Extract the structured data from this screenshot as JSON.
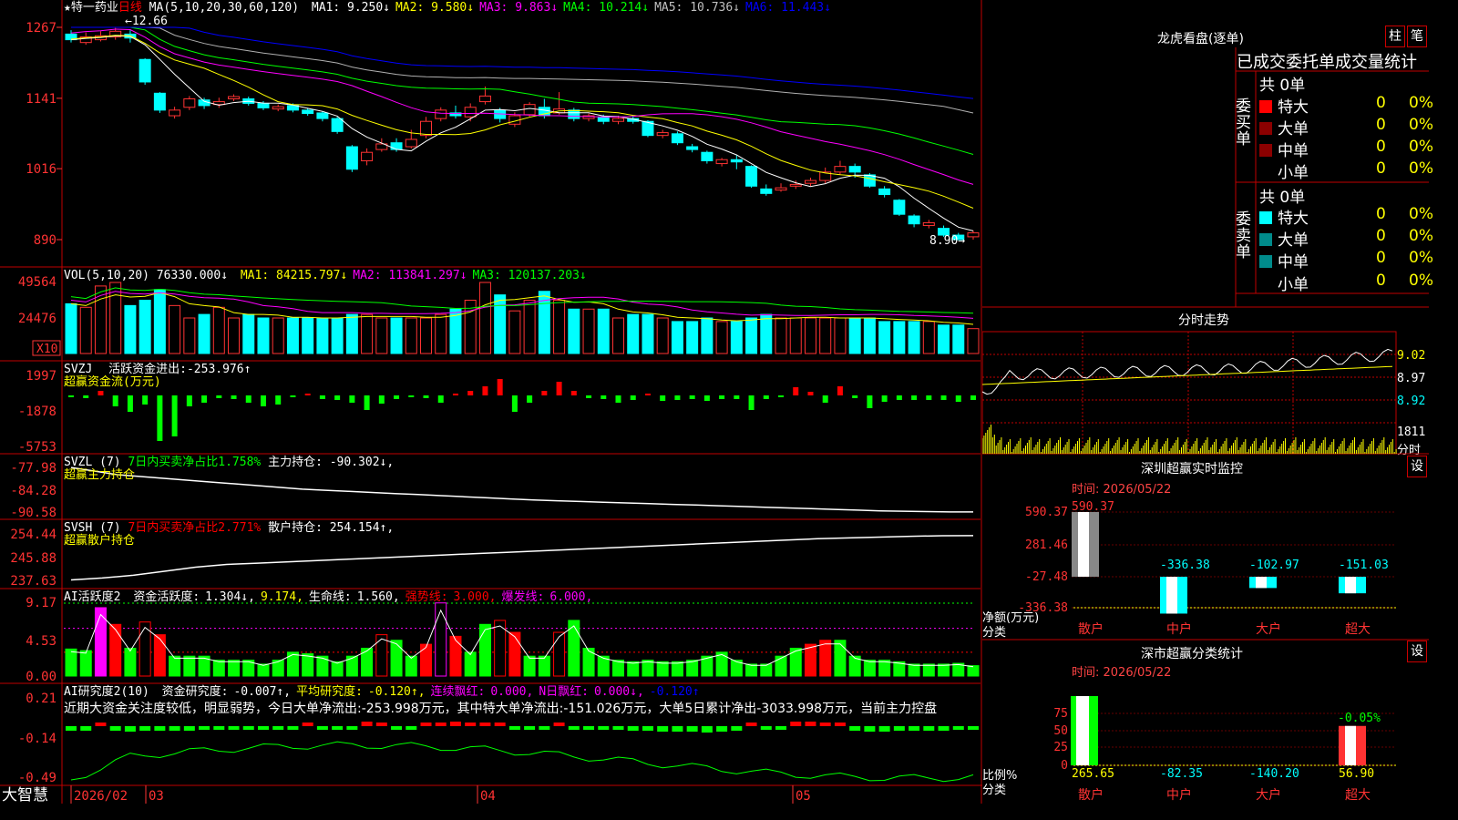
{
  "colors": {
    "up": "#ff3333",
    "down": "#00ffff",
    "vol_up": "#ff3333",
    "vol_down": "#00ffff",
    "frame": "#c00000",
    "ma1": "#ffffff",
    "ma2": "#ffff00",
    "ma3": "#ff00ff",
    "ma4": "#00ff00",
    "ma5": "#b0b0b0",
    "ma6": "#0000ff",
    "green_bar": "#00ff00",
    "red_bar": "#ff0000",
    "magenta_bar": "#ff00ff"
  },
  "price_panel": {
    "stock_name": "★特一药业",
    "period": "日线",
    "ma_label": "MA(5,10,20,30,60,120)",
    "ma_values": [
      {
        "name": "MA1:",
        "value": "9.250↓",
        "color": "#ffffff"
      },
      {
        "name": "MA2:",
        "value": "9.580↓",
        "color": "#ffff00"
      },
      {
        "name": "MA3:",
        "value": "9.863↓",
        "color": "#ff00ff"
      },
      {
        "name": "MA4:",
        "value": "10.214↓",
        "color": "#00ff00"
      },
      {
        "name": "MA5:",
        "value": "10.736↓",
        "color": "#c0c0c0"
      },
      {
        "name": "MA6:",
        "value": "11.443↓",
        "color": "#0000ff"
      }
    ],
    "y_ticks": [
      "1267",
      "1141",
      "1016",
      "890"
    ],
    "high_label": "12.66",
    "low_label": "8.90"
  },
  "vol_panel": {
    "label": "VOL(5,10,20)",
    "value": "76330.000↓",
    "ma_values": [
      {
        "name": "MA1:",
        "value": "84215.797↓",
        "color": "#ffff00"
      },
      {
        "name": "MA2:",
        "value": "113841.297↓",
        "color": "#ff00ff"
      },
      {
        "name": "MA3:",
        "value": "120137.203↓",
        "color": "#00ff00"
      }
    ],
    "y_ticks": [
      "49564",
      "24476"
    ],
    "unit": "X10"
  },
  "svzj_panel": {
    "label": "SVZJ",
    "desc": "活跃资金进出:",
    "value": "-253.976↑",
    "sub": "超赢资金流(万元)",
    "y_ticks": [
      "1997",
      "-1878",
      "-5753"
    ]
  },
  "svzl_panel": {
    "label": "SVZL (7)",
    "desc": "7日内买卖净占比1.758%",
    "desc2": "主力持仓:",
    "value": "-90.302↓,",
    "sub": "超赢主力持仓",
    "y_ticks": [
      "-77.98",
      "-84.28",
      "-90.58"
    ]
  },
  "svsh_panel": {
    "label": "SVSH (7)",
    "desc": "7日内买卖净占比2.771%",
    "desc2": "散户持仓:",
    "value": "254.154↑,",
    "sub": "超赢散户持仓",
    "y_ticks": [
      "254.44",
      "245.88",
      "237.63"
    ]
  },
  "ai1_panel": {
    "label": "AI活跃度2",
    "items": [
      {
        "t": "资金活跃度:",
        "c": "#ffffff"
      },
      {
        "t": "1.304↓,",
        "c": "#ffffff"
      },
      {
        "t": "9.174,",
        "c": "#ffff00"
      },
      {
        "t": "生命线:",
        "c": "#ffffff"
      },
      {
        "t": "1.560,",
        "c": "#ffffff"
      },
      {
        "t": "强势线:",
        "c": "#ff0000"
      },
      {
        "t": "3.000,",
        "c": "#ff0000"
      },
      {
        "t": "爆发线:",
        "c": "#ff00ff"
      },
      {
        "t": "6.000,",
        "c": "#ff00ff"
      }
    ],
    "y_ticks": [
      "9.17",
      "4.53",
      "0.00"
    ]
  },
  "ai2_panel": {
    "label": "AI研究度2(10)",
    "items": [
      {
        "t": "资金研究度:",
        "c": "#ffffff"
      },
      {
        "t": "-0.007↑,",
        "c": "#ffffff"
      },
      {
        "t": "平均研究度:",
        "c": "#ffff00"
      },
      {
        "t": "-0.120↑,",
        "c": "#ffff00"
      },
      {
        "t": "连续飘红:",
        "c": "#ff00ff"
      },
      {
        "t": "0.000,",
        "c": "#ff00ff"
      },
      {
        "t": "N日飘红:",
        "c": "#ff00ff"
      },
      {
        "t": "0.000↓,",
        "c": "#ff00ff"
      },
      {
        "t": "-0.120↑",
        "c": "#0000ff"
      }
    ],
    "comment": "近期大资金关注度较低，明显弱势，今日大单净流出:-253.998万元，其中特大单净流出:-151.026万元，大单5日累计净出-3033.998万元，当前主力控盘",
    "y_ticks": [
      "0.21",
      "-0.14",
      "-0.49"
    ]
  },
  "x_axis": {
    "brand": "大智慧",
    "labels": [
      "2026/02",
      "03",
      "04",
      "05"
    ]
  },
  "lhb": {
    "title": "龙虎看盘(逐单)",
    "tab_col": "柱",
    "tab_row": "笔",
    "header": "已成交委托单成交量统计",
    "buy_side": "委买单",
    "sell_side": "委卖单",
    "buy_total": "共 0单",
    "sell_total": "共 0单",
    "rows": [
      {
        "name": "特大",
        "count": "0",
        "pct": "0%"
      },
      {
        "name": "大单",
        "count": "0",
        "pct": "0%"
      },
      {
        "name": "中单",
        "count": "0",
        "pct": "0%"
      },
      {
        "name": "小单",
        "count": "0",
        "pct": "0%"
      }
    ]
  },
  "intraday": {
    "title": "分时走势",
    "price_ticks": [
      "9.02",
      "8.97",
      "8.92"
    ],
    "vol_tick": "1811",
    "vol_unit": "分时"
  },
  "sz_monitor": {
    "title": "深圳超赢实时监控",
    "time": "时间: 2026/05/22",
    "settings": "设",
    "y_ticks": [
      "590.37",
      "281.46",
      "-27.48",
      "-336.38"
    ],
    "ylabel": "净额(万元)",
    "xlabel": "分类",
    "categories": [
      "散户",
      "中户",
      "大户",
      "超大"
    ],
    "values": [
      590.37,
      -336.38,
      -102.97,
      -151.03
    ],
    "value_labels": [
      "590.37",
      "-336.38",
      "-102.97",
      "-151.03"
    ]
  },
  "sz_class": {
    "title": "深市超赢分类统计",
    "time": "时间: 2026/05/22",
    "settings": "设",
    "y_ticks": [
      "75",
      "50",
      "25",
      "0"
    ],
    "ylabel": "比例%",
    "xlabel": "分类",
    "categories": [
      "散户",
      "中户",
      "大户",
      "超大"
    ],
    "values": [
      265.65,
      -82.35,
      -140.2,
      56.9
    ],
    "value_labels": [
      "265.65",
      "-82.35",
      "-140.20",
      "56.90"
    ],
    "top_label": "-0.05%"
  },
  "chart_data": [
    {
      "type": "candlestick",
      "title": "★特一药业 日线",
      "ylim": [
        8.9,
        12.67
      ],
      "x": [
        "2026/02",
        "03",
        "04",
        "05"
      ],
      "series": [
        {
          "name": "K线",
          "ohlc": [
            [
              12.55,
              12.45,
              12.62,
              12.4
            ],
            [
              12.4,
              12.5,
              12.58,
              12.36
            ],
            [
              12.45,
              12.52,
              12.6,
              12.42
            ],
            [
              12.5,
              12.6,
              12.66,
              12.45
            ],
            [
              12.55,
              12.48,
              12.62,
              12.4
            ],
            [
              12.1,
              11.7,
              12.12,
              11.65
            ],
            [
              11.5,
              11.2,
              11.52,
              11.15
            ],
            [
              11.1,
              11.2,
              11.26,
              11.05
            ],
            [
              11.25,
              11.4,
              11.45,
              11.2
            ],
            [
              11.38,
              11.28,
              11.42,
              11.22
            ],
            [
              11.3,
              11.35,
              11.42,
              11.24
            ],
            [
              11.4,
              11.44,
              11.48,
              11.36
            ],
            [
              11.4,
              11.32,
              11.44,
              11.28
            ],
            [
              11.32,
              11.24,
              11.36,
              11.2
            ],
            [
              11.22,
              11.26,
              11.3,
              11.18
            ],
            [
              11.28,
              11.2,
              11.32,
              11.16
            ],
            [
              11.2,
              11.14,
              11.24,
              11.1
            ],
            [
              11.15,
              11.05,
              11.18,
              11.0
            ],
            [
              11.05,
              10.82,
              11.08,
              10.78
            ],
            [
              10.55,
              10.15,
              10.58,
              10.1
            ],
            [
              10.3,
              10.45,
              10.52,
              10.22
            ],
            [
              10.5,
              10.6,
              10.7,
              10.46
            ],
            [
              10.62,
              10.5,
              10.7,
              10.46
            ],
            [
              10.55,
              10.68,
              10.85,
              10.52
            ],
            [
              10.75,
              11.0,
              11.08,
              10.7
            ],
            [
              11.05,
              11.2,
              11.25,
              11.0
            ],
            [
              11.15,
              11.1,
              11.28,
              11.05
            ],
            [
              11.08,
              11.25,
              11.32,
              11.0
            ],
            [
              11.35,
              11.45,
              11.62,
              11.3
            ],
            [
              11.2,
              11.05,
              11.24,
              10.98
            ],
            [
              10.95,
              11.1,
              11.16,
              10.9
            ],
            [
              11.12,
              11.3,
              11.34,
              11.08
            ],
            [
              11.25,
              11.1,
              11.4,
              11.05
            ],
            [
              11.15,
              11.22,
              11.52,
              11.12
            ],
            [
              11.2,
              11.05,
              11.24,
              11.0
            ],
            [
              11.05,
              11.1,
              11.14,
              11.0
            ],
            [
              11.08,
              11.0,
              11.12,
              10.95
            ],
            [
              11.0,
              11.05,
              11.1,
              10.95
            ],
            [
              11.05,
              11.0,
              11.1,
              10.96
            ],
            [
              11.0,
              10.75,
              11.02,
              10.72
            ],
            [
              10.75,
              10.8,
              10.85,
              10.7
            ],
            [
              10.78,
              10.62,
              10.82,
              10.58
            ],
            [
              10.55,
              10.5,
              10.6,
              10.45
            ],
            [
              10.45,
              10.3,
              10.48,
              10.25
            ],
            [
              10.25,
              10.32,
              10.35,
              10.2
            ],
            [
              10.32,
              10.28,
              10.4,
              10.15
            ],
            [
              10.2,
              9.85,
              10.22,
              9.82
            ],
            [
              9.8,
              9.72,
              9.88,
              9.68
            ],
            [
              9.78,
              9.82,
              9.9,
              9.75
            ],
            [
              9.85,
              9.88,
              9.95,
              9.8
            ],
            [
              9.9,
              9.95,
              10.0,
              9.85
            ],
            [
              9.95,
              10.1,
              10.18,
              9.9
            ],
            [
              10.1,
              10.2,
              10.3,
              10.05
            ],
            [
              10.2,
              10.1,
              10.25,
              10.0
            ],
            [
              10.05,
              9.85,
              10.08,
              9.82
            ],
            [
              9.8,
              9.7,
              9.85,
              9.65
            ],
            [
              9.6,
              9.35,
              9.62,
              9.32
            ],
            [
              9.32,
              9.18,
              9.35,
              9.12
            ],
            [
              9.15,
              9.2,
              9.25,
              9.1
            ],
            [
              9.1,
              8.98,
              9.15,
              8.95
            ],
            [
              8.98,
              8.9,
              9.02,
              8.9
            ],
            [
              8.95,
              9.02,
              9.06,
              8.9
            ]
          ]
        }
      ]
    },
    {
      "type": "bar",
      "title": "VOL(5,10,20)",
      "series": [
        {
          "name": "VOL",
          "values": [
            28,
            26,
            38,
            40,
            27,
            30,
            36,
            27,
            20,
            22,
            26,
            20,
            22,
            20,
            20,
            20,
            20,
            20,
            20,
            22,
            22,
            20,
            20,
            20,
            20,
            22,
            25,
            30,
            40,
            33,
            24,
            30,
            35,
            30,
            25,
            25,
            25,
            20,
            22,
            22,
            20,
            18,
            18,
            20,
            18,
            18,
            20,
            22,
            20,
            20,
            20,
            20,
            20,
            20,
            20,
            18,
            18,
            18,
            18,
            16,
            16,
            14
          ]
        }
      ]
    },
    {
      "type": "bar",
      "title": "SVZJ 活跃资金进出",
      "series": [
        {
          "name": "超赢资金流(万元)",
          "values": [
            -200,
            -300,
            500,
            -1200,
            -1800,
            -1000,
            -5000,
            -4500,
            -1200,
            -800,
            -300,
            -400,
            -800,
            -1200,
            -1000,
            -200,
            200,
            -400,
            -500,
            -800,
            -1600,
            -900,
            -400,
            -200,
            -300,
            -800,
            200,
            500,
            1000,
            1800,
            -1800,
            -800,
            500,
            1500,
            500,
            -300,
            -400,
            -800,
            -500,
            200,
            -600,
            -500,
            -400,
            -600,
            -400,
            -400,
            -1600,
            -400,
            -200,
            900,
            400,
            -800,
            1000,
            -300,
            -1400,
            -700,
            -500,
            -500,
            -500,
            -500,
            -700,
            -500
          ]
        }
      ]
    },
    {
      "type": "line",
      "title": "SVZL 主力持仓",
      "series": [
        {
          "name": "超赢主力持仓",
          "values": [
            -78.0,
            -79.0,
            -80.0,
            -80.5,
            -81.0,
            -81.5,
            -82.0,
            -82.5,
            -83.0,
            -83.5,
            -84.0,
            -84.3,
            -84.6,
            -84.9,
            -85.2,
            -85.5,
            -85.8,
            -86.1,
            -86.4,
            -86.7,
            -87.0,
            -87.2,
            -87.4,
            -87.6,
            -87.8,
            -88.0,
            -88.2,
            -88.4,
            -88.6,
            -88.8,
            -89.0,
            -89.2,
            -89.4,
            -89.6,
            -89.8,
            -90.0,
            -90.1,
            -90.2,
            -90.3,
            -90.302
          ]
        }
      ]
    },
    {
      "type": "line",
      "title": "SVSH 散户持仓",
      "series": [
        {
          "name": "超赢散户持仓",
          "values": [
            237.8,
            238.5,
            239.5,
            241.0,
            242.5,
            243.5,
            244.0,
            244.5,
            245.0,
            245.5,
            246.0,
            246.5,
            247.0,
            247.5,
            248.0,
            248.5,
            249.0,
            249.5,
            250.0,
            250.5,
            251.0,
            251.5,
            252.0,
            252.5,
            253.0,
            253.3,
            253.6,
            253.9,
            254.1,
            254.154
          ]
        }
      ]
    },
    {
      "type": "bar",
      "title": "AI活跃度2",
      "series": [
        {
          "name": "资金活跃度",
          "values": [
            3.4,
            3.2,
            8.6,
            6.5,
            3.5,
            6.8,
            5.2,
            2.5,
            2.5,
            2.5,
            2.0,
            2.0,
            2.0,
            1.5,
            2.0,
            3.0,
            2.8,
            2.5,
            1.8,
            2.5,
            3.5,
            5.2,
            4.5,
            2.5,
            4.0,
            9.2,
            5.0,
            3.0,
            6.5,
            7.0,
            5.5,
            2.5,
            2.5,
            5.5,
            7.0,
            3.5,
            2.5,
            2.0,
            1.8,
            2.0,
            1.8,
            1.8,
            2.0,
            2.5,
            3.0,
            2.0,
            1.5,
            1.5,
            2.5,
            3.5,
            4.0,
            4.5,
            4.5,
            2.5,
            2.0,
            2.0,
            1.8,
            1.5,
            1.5,
            1.5,
            1.6,
            1.304
          ]
        }
      ]
    },
    {
      "type": "bar",
      "title": "AI研究度2(10)",
      "series": [
        {
          "name": "资金研究度",
          "values": [
            -0.05,
            -0.05,
            0.03,
            -0.05,
            -0.06,
            -0.05,
            -0.05,
            -0.05,
            -0.05,
            -0.04,
            -0.04,
            -0.04,
            -0.03,
            -0.04,
            -0.04,
            -0.03,
            0.03,
            -0.03,
            -0.03,
            -0.02,
            0.05,
            0.04,
            -0.02,
            -0.03,
            0.03,
            0.04,
            0.05,
            0.04,
            0.03,
            0.03,
            -0.03,
            -0.03,
            -0.03,
            0.04,
            -0.03,
            -0.03,
            -0.04,
            -0.04,
            -0.05,
            -0.05,
            -0.06,
            -0.06,
            -0.06,
            -0.07,
            -0.06,
            -0.05,
            0.04,
            -0.04,
            -0.03,
            0.05,
            0.05,
            0.04,
            0.04,
            -0.05,
            -0.06,
            -0.06,
            -0.05,
            -0.05,
            -0.05,
            -0.05,
            -0.04,
            -0.007
          ]
        }
      ]
    }
  ]
}
